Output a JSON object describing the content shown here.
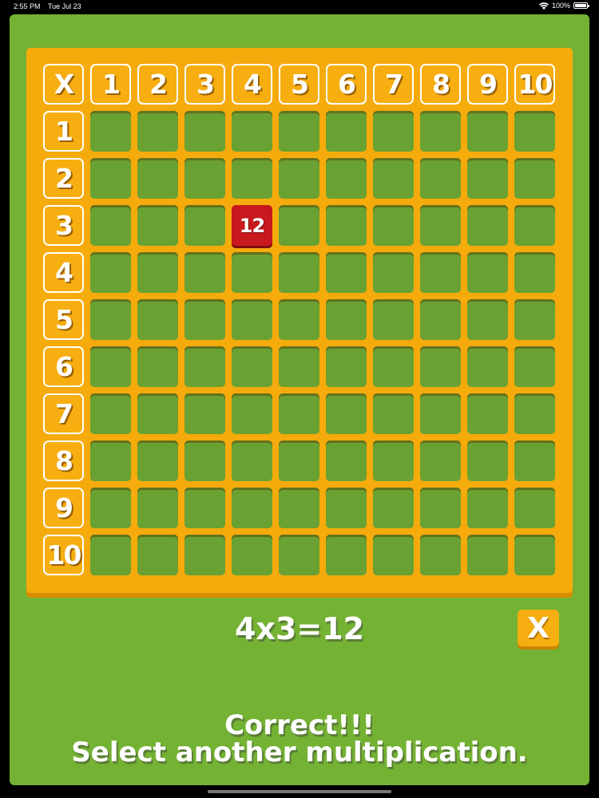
{
  "status_bar": {
    "time": "2:55 PM",
    "date": "Tue Jul 23",
    "battery": "100%"
  },
  "board": {
    "corner": "X",
    "columns": [
      "1",
      "2",
      "3",
      "4",
      "5",
      "6",
      "7",
      "8",
      "9",
      "10"
    ],
    "rows": [
      "1",
      "2",
      "3",
      "4",
      "5",
      "6",
      "7",
      "8",
      "9",
      "10"
    ],
    "filled": [
      {
        "row": 3,
        "col": 4,
        "value": "12"
      }
    ],
    "colors": {
      "board": "#f5ab0c",
      "slot": "#6aa133",
      "filled": "#c8191e",
      "background": "#74b233"
    }
  },
  "equation": "4x3=12",
  "close_button_label": "X",
  "feedback": {
    "line1": "Correct!!!",
    "line2": "Select another multiplication."
  }
}
